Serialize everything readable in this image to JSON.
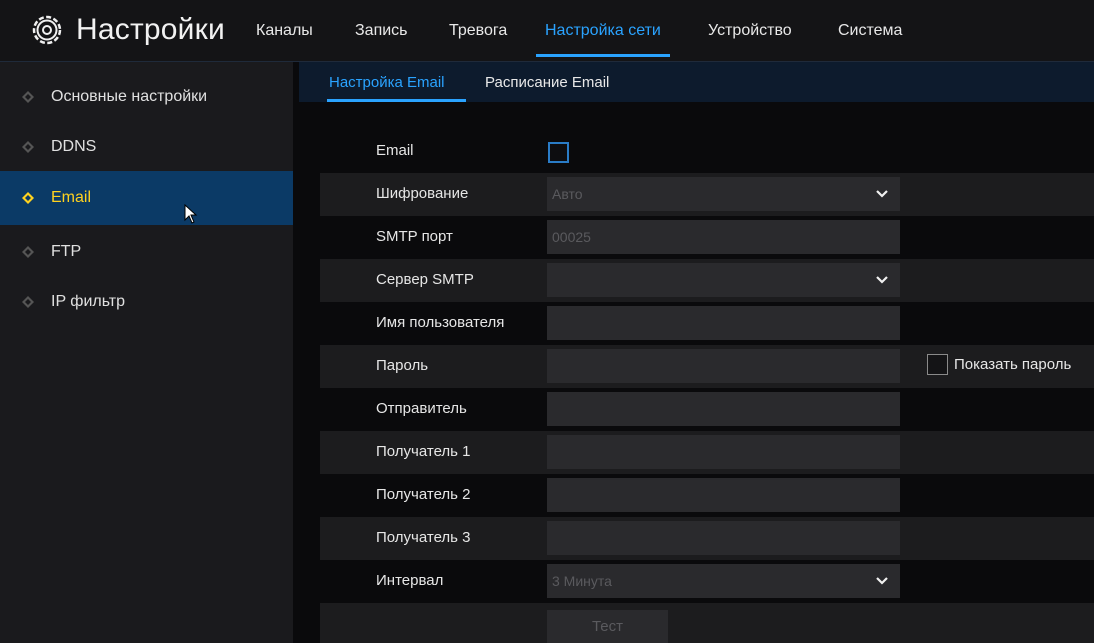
{
  "header": {
    "title": "Настройки",
    "icon": "gear-icon",
    "nav": [
      {
        "label": "Каналы",
        "active": false
      },
      {
        "label": "Запись",
        "active": false
      },
      {
        "label": "Тревога",
        "active": false
      },
      {
        "label": "Настройка сети",
        "active": true
      },
      {
        "label": "Устройство",
        "active": false
      },
      {
        "label": "Система",
        "active": false
      }
    ]
  },
  "sidebar": {
    "items": [
      {
        "label": "Основные настройки",
        "active": false
      },
      {
        "label": "DDNS",
        "active": false
      },
      {
        "label": "Email",
        "active": true
      },
      {
        "label": "FTP",
        "active": false
      },
      {
        "label": "IP фильтр",
        "active": false
      }
    ]
  },
  "subtabs": [
    {
      "label": "Настройка Email",
      "active": true
    },
    {
      "label": "Расписание Email",
      "active": false
    }
  ],
  "form": {
    "email": {
      "label": "Email",
      "checked": false
    },
    "encryption": {
      "label": "Шифрование",
      "value": "Авто"
    },
    "smtp_port": {
      "label": "SMTP порт",
      "value": "00025"
    },
    "smtp_server": {
      "label": "Сервер SMTP",
      "value": ""
    },
    "username": {
      "label": "Имя пользователя",
      "value": ""
    },
    "password": {
      "label": "Пароль",
      "value": "",
      "show_password_label": "Показать пароль"
    },
    "sender": {
      "label": "Отправитель",
      "value": ""
    },
    "recipient1": {
      "label": "Получатель 1",
      "value": ""
    },
    "recipient2": {
      "label": "Получатель 2",
      "value": ""
    },
    "recipient3": {
      "label": "Получатель 3",
      "value": ""
    },
    "interval": {
      "label": "Интервал",
      "value": "3 Минута"
    },
    "test_button": "Тест"
  },
  "colors": {
    "accent": "#2aa3ff",
    "active_sidebar_bg": "#0b3a66",
    "active_sidebar_text": "#ffd21f"
  }
}
